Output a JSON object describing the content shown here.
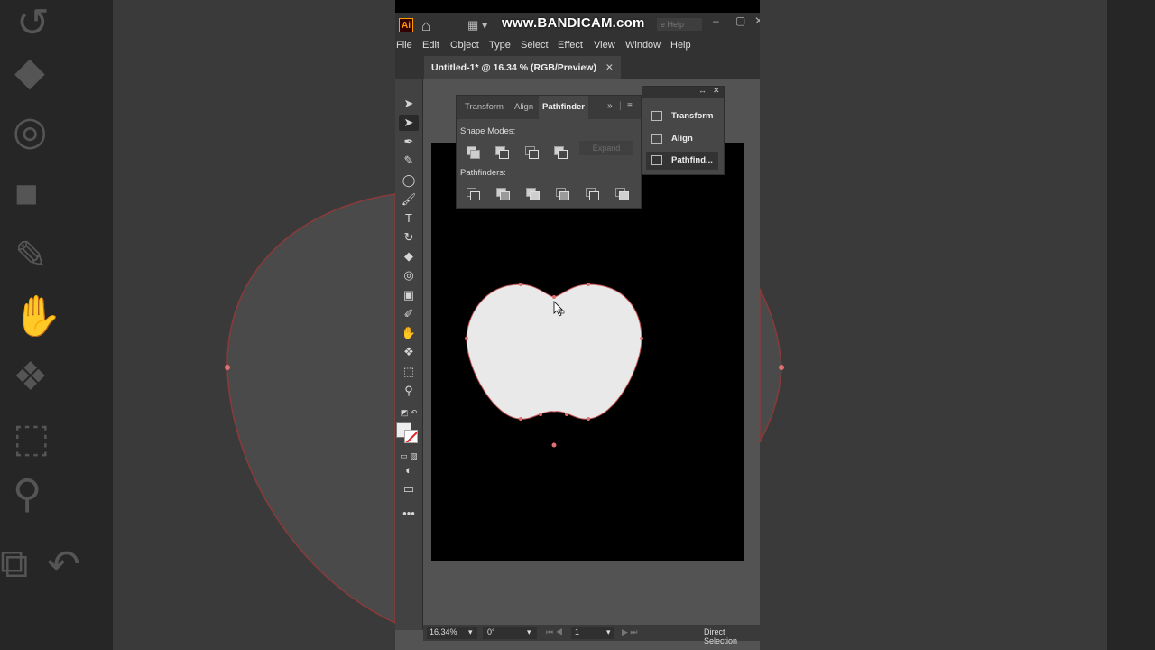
{
  "watermark": "www.BANDICAM.com",
  "app": {
    "logo": "Ai",
    "search_placeholder": "e Help",
    "menu": [
      "File",
      "Edit",
      "Object",
      "Type",
      "Select",
      "Effect",
      "View",
      "Window",
      "Help"
    ]
  },
  "document": {
    "tab_title": "Untitled-1* @ 16.34 % (RGB/Preview)",
    "close": "✕"
  },
  "pathfinder_panel": {
    "tabs": [
      "Transform",
      "Align",
      "Pathfinder"
    ],
    "active_tab": "Pathfinder",
    "shape_modes_label": "Shape Modes:",
    "expand_label": "Expand",
    "pathfinders_label": "Pathfinders:"
  },
  "dock_panel": {
    "items": [
      "Transform",
      "Align",
      "Pathfind..."
    ]
  },
  "status": {
    "zoom": "16.34%",
    "rotation": "0°",
    "artboard": "1",
    "tool": "Direct Selection"
  },
  "icons": {
    "tools": [
      "direct-selection-icon",
      "group-selection-icon",
      "pen-icon",
      "curvature-icon",
      "ellipse-icon",
      "paintbrush-icon",
      "type-icon",
      "rotate-icon",
      "eraser-icon",
      "shape-builder-icon",
      "gradient-icon",
      "eyedropper-icon",
      "puppet-warp-icon",
      "symbol-sprayer-icon",
      "artboard-icon",
      "zoom-icon"
    ]
  },
  "colors": {
    "fill": "#e9e9e9",
    "anchor": "#e07070",
    "path": "#c05050"
  }
}
